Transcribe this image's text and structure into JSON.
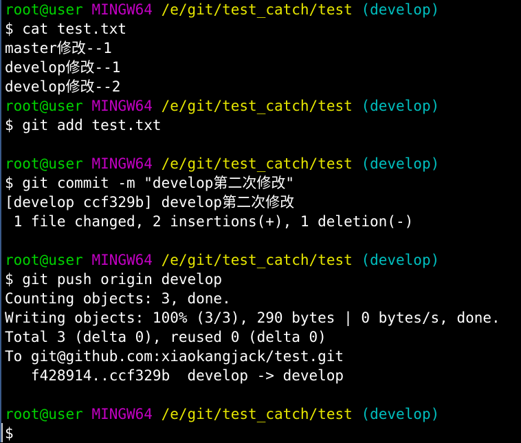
{
  "colors": {
    "background": "#000000",
    "text": "#ffffff",
    "user": "#00d200",
    "shell": "#c200c2",
    "path": "#e6e600",
    "branch": "#00bfbf"
  },
  "prompt": {
    "user": "root@user",
    "shell": "MINGW64",
    "path": "/e/git/test_catch/test",
    "branch": "(develop)"
  },
  "lines": [
    {
      "type": "prompt"
    },
    {
      "type": "text",
      "text": "$ cat test.txt"
    },
    {
      "type": "text",
      "text": "master修改--1"
    },
    {
      "type": "text",
      "text": "develop修改--1"
    },
    {
      "type": "text",
      "text": "develop修改--2"
    },
    {
      "type": "prompt"
    },
    {
      "type": "text",
      "text": "$ git add test.txt"
    },
    {
      "type": "text",
      "text": ""
    },
    {
      "type": "prompt"
    },
    {
      "type": "text",
      "text": "$ git commit -m \"develop第二次修改\""
    },
    {
      "type": "text",
      "text": "[develop ccf329b] develop第二次修改"
    },
    {
      "type": "text",
      "text": " 1 file changed, 2 insertions(+), 1 deletion(-)"
    },
    {
      "type": "text",
      "text": ""
    },
    {
      "type": "prompt"
    },
    {
      "type": "text",
      "text": "$ git push origin develop"
    },
    {
      "type": "text",
      "text": "Counting objects: 3, done."
    },
    {
      "type": "text",
      "text": "Writing objects: 100% (3/3), 290 bytes | 0 bytes/s, done."
    },
    {
      "type": "text",
      "text": "Total 3 (delta 0), reused 0 (delta 0)"
    },
    {
      "type": "text",
      "text": "To git@github.com:xiaokangjack/test.git"
    },
    {
      "type": "text",
      "text": "   f428914..ccf329b  develop -> develop"
    },
    {
      "type": "text",
      "text": ""
    },
    {
      "type": "prompt"
    },
    {
      "type": "text",
      "text": "$"
    }
  ]
}
